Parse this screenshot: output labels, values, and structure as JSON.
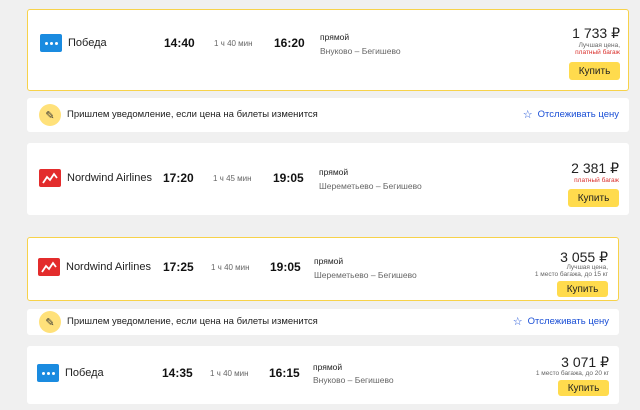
{
  "flights": [
    {
      "airline": "Победа",
      "logo": "pobeda-logo",
      "depart": "14:40",
      "duration": "1 ч 40 мин",
      "arrive": "16:20",
      "route_type": "прямой",
      "route": "Внуково – Бегишево",
      "price": "1 733 ₽",
      "notes": [
        {
          "text": "Лучшая цена,",
          "tone": "grey"
        },
        {
          "text": "платный багаж",
          "tone": "red"
        }
      ],
      "buy_label": "Купить"
    },
    {
      "airline": "Nordwind Airlines",
      "logo": "nordwind-logo",
      "depart": "17:20",
      "duration": "1 ч 45 мин",
      "arrive": "19:05",
      "route_type": "прямой",
      "route": "Шереметьево – Бегишево",
      "price": "2 381 ₽",
      "notes": [
        {
          "text": "платный багаж",
          "tone": "red"
        }
      ],
      "buy_label": "Купить"
    },
    {
      "airline": "Nordwind Airlines",
      "logo": "nordwind-logo",
      "depart": "17:25",
      "duration": "1 ч 40 мин",
      "arrive": "19:05",
      "route_type": "прямой",
      "route": "Шереметьево – Бегишево",
      "price": "3 055 ₽",
      "notes": [
        {
          "text": "Лучшая цена,",
          "tone": "grey"
        },
        {
          "text": "1 место багажа, до 15 кг",
          "tone": "grey"
        }
      ],
      "buy_label": "Купить"
    },
    {
      "airline": "Победа",
      "logo": "pobeda-logo",
      "depart": "14:35",
      "duration": "1 ч 40 мин",
      "arrive": "16:15",
      "route_type": "прямой",
      "route": "Внуково – Бегишево",
      "price": "3 071 ₽",
      "notes": [
        {
          "text": "1 место багажа, до 20 кг",
          "tone": "grey"
        }
      ],
      "buy_label": "Купить"
    }
  ],
  "alert": {
    "icon": "price-alert-icon",
    "text": "Пришлем уведомление, если цена на билеты изменится",
    "track_icon": "star-icon",
    "track_label": "Отслеживать цену"
  },
  "colors": {
    "accent_button": "#ffdb4d",
    "highlight_border": "#f7d24a",
    "link_blue": "#1a4fd6",
    "warning_red": "#d9302c",
    "pobeda_blue": "#1a8be0",
    "nordwind_red": "#e32c2c"
  }
}
